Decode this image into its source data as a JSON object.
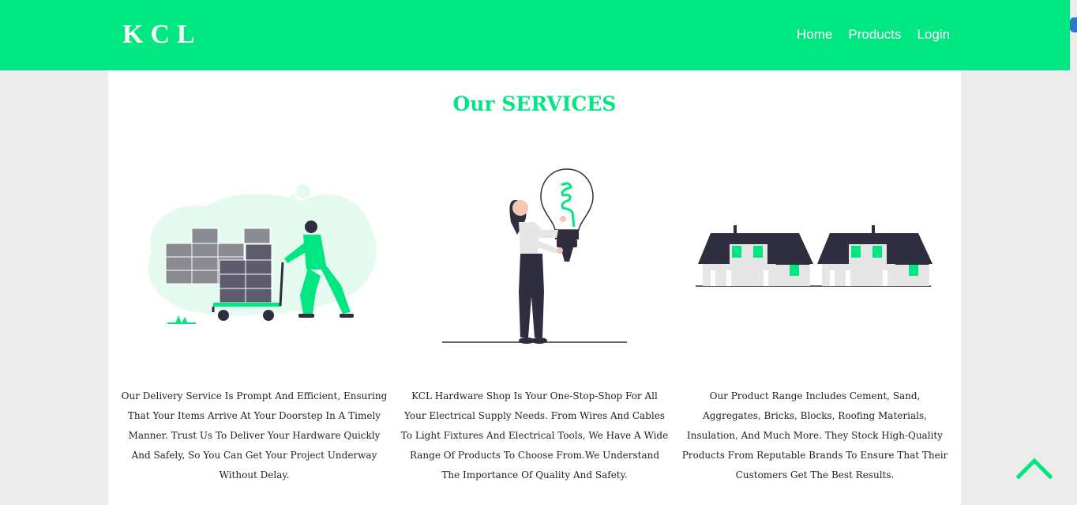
{
  "nav": {
    "brand": "KCL",
    "links": [
      "Home",
      "Products",
      "Login"
    ]
  },
  "services": {
    "title": "Our SERVICES",
    "cards": [
      {
        "illustration": "delivery-illustration",
        "text": "Our Delivery Service Is Prompt And Efficient, Ensuring That Your Items Arrive At Your Doorstep In A Timely Manner. Trust Us To Deliver Your Hardware Quickly And Safely, So You Can Get Your Project Underway Without Delay."
      },
      {
        "illustration": "lightbulb-illustration",
        "text": "KCL Hardware Shop Is Your One-Stop-Shop For All Your Electrical Supply Needs. From Wires And Cables To Light Fixtures And Electrical Tools, We Have A Wide Range Of Products To Choose From.We Understand The Importance Of Quality And Safety."
      },
      {
        "illustration": "houses-illustration",
        "text": "Our Product Range Includes Cement, Sand, Aggregates, Bricks, Blocks, Roofing Materials, Insulation, And Much More. They Stock High-Quality Products From Reputable Brands To Ensure That Their Customers Get The Best Results."
      }
    ]
  },
  "icons": {
    "back_to_top": "chevron-up-icon"
  },
  "colors": {
    "accent": "#00e680",
    "dark": "#2f2e41",
    "text": "#222222",
    "page_bg": "#ececec"
  }
}
